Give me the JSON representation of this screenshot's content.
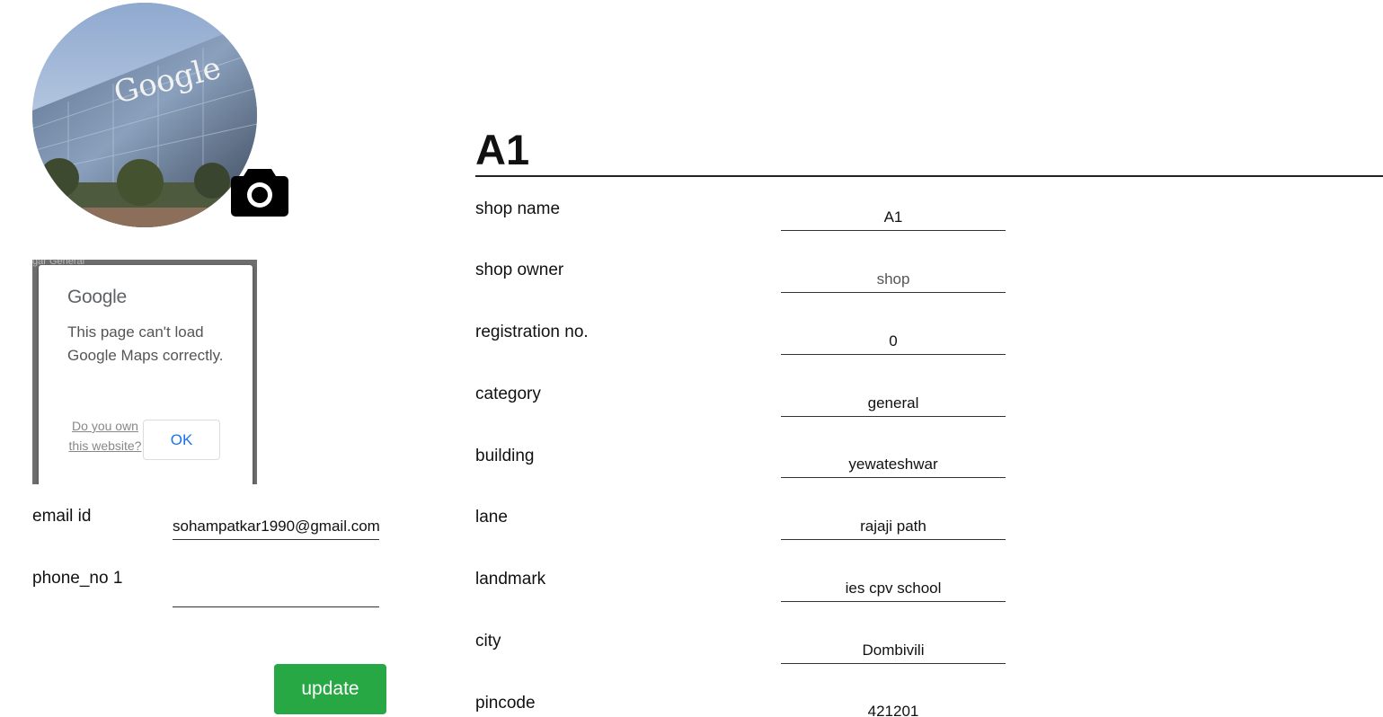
{
  "profile": {
    "photo_alt": "Google",
    "camera_icon": "camera-icon"
  },
  "map": {
    "background_text": "gar General",
    "logo_text": "Google",
    "message": "This page can't load Google Maps correctly.",
    "owner_link": "Do you own this website?",
    "ok_label": "OK"
  },
  "contact": {
    "email_label": "email id",
    "email_value": "sohampatkar1990@gmail.com",
    "phone_label": "phone_no 1",
    "phone_value": ""
  },
  "update_label": "update",
  "shop": {
    "title": "A1",
    "fields": [
      {
        "label": "shop name",
        "value": "A1"
      },
      {
        "label": "shop owner",
        "value": "shop"
      },
      {
        "label": "registration no.",
        "value": "0"
      },
      {
        "label": "category",
        "value": "general"
      },
      {
        "label": "building",
        "value": "yewateshwar"
      },
      {
        "label": "lane",
        "value": "rajaji path"
      },
      {
        "label": "landmark",
        "value": "ies cpv school"
      },
      {
        "label": "city",
        "value": "Dombivili"
      },
      {
        "label": "pincode",
        "value": "421201"
      }
    ]
  }
}
